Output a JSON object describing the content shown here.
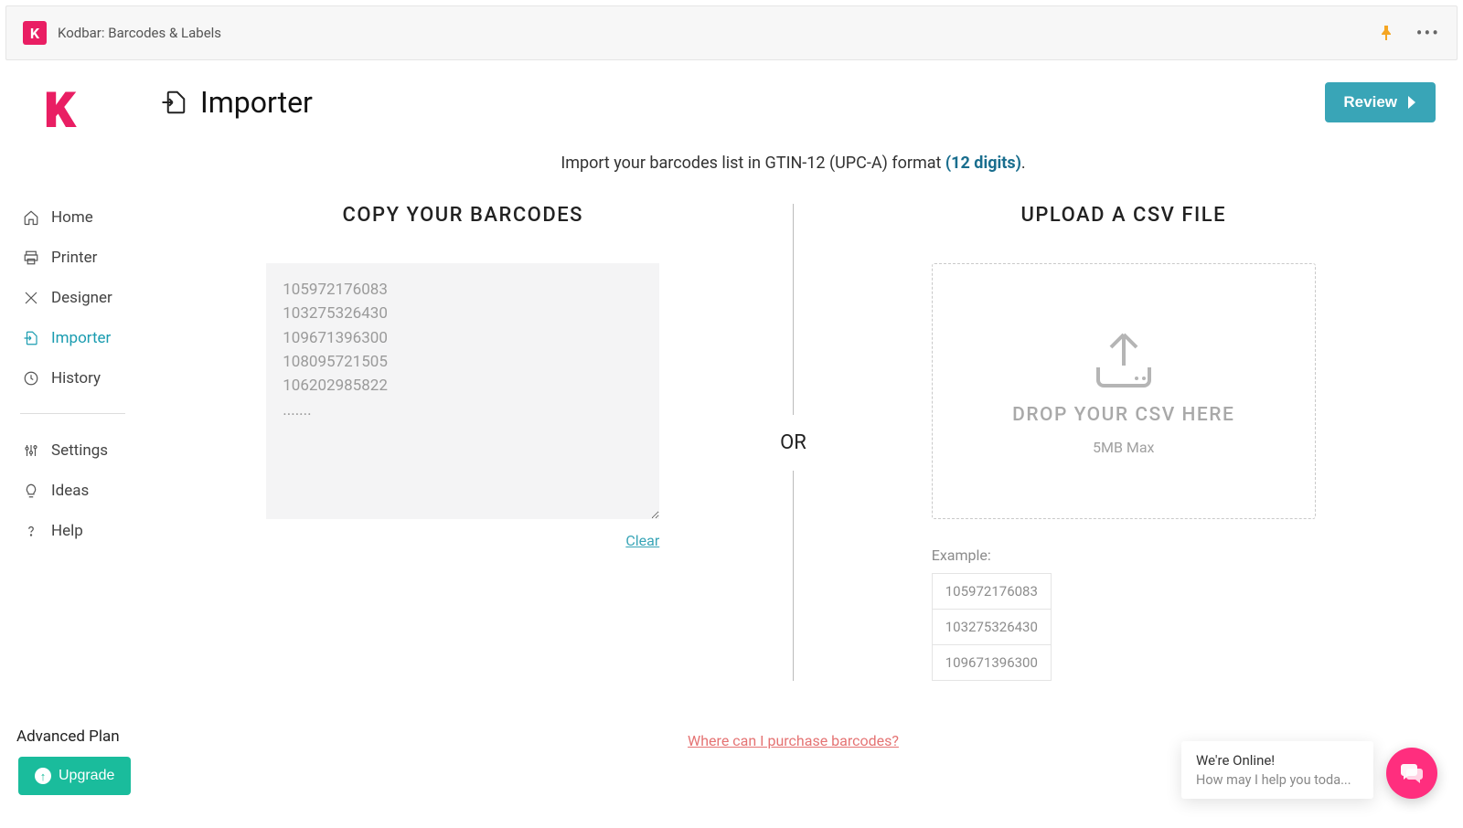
{
  "titlebar": {
    "app_name": "Kodbar: Barcodes & Labels"
  },
  "header": {
    "page_title": "Importer",
    "review_label": "Review"
  },
  "sidebar": {
    "items": [
      {
        "label": "Home",
        "icon": "home"
      },
      {
        "label": "Printer",
        "icon": "printer"
      },
      {
        "label": "Designer",
        "icon": "designer"
      },
      {
        "label": "Importer",
        "icon": "importer",
        "active": true
      },
      {
        "label": "History",
        "icon": "history"
      }
    ],
    "secondary": [
      {
        "label": "Settings",
        "icon": "settings"
      },
      {
        "label": "Ideas",
        "icon": "ideas"
      },
      {
        "label": "Help",
        "icon": "help"
      }
    ],
    "plan_label": "Advanced Plan",
    "upgrade_label": "Upgrade"
  },
  "intro": {
    "prefix": "Import your barcodes list in GTIN-12 (UPC-A) format ",
    "link_text": "(12 digits)",
    "suffix": "."
  },
  "left": {
    "heading": "Copy your barcodes",
    "placeholder": "105972176083\n103275326430\n109671396300\n108095721505\n106202985822\n.......",
    "clear_label": "Clear"
  },
  "divider": {
    "or": "OR"
  },
  "right": {
    "heading": "Upload a CSV file",
    "drop_text": "DROP YOUR CSV HERE",
    "drop_sub": "5MB Max",
    "example_label": "Example:",
    "example_rows": [
      "105972176083",
      "103275326430",
      "109671396300"
    ]
  },
  "purchase": {
    "text": "Where can I purchase barcodes?"
  },
  "chat": {
    "line1": "We're Online!",
    "line2": "How may I help you toda..."
  }
}
